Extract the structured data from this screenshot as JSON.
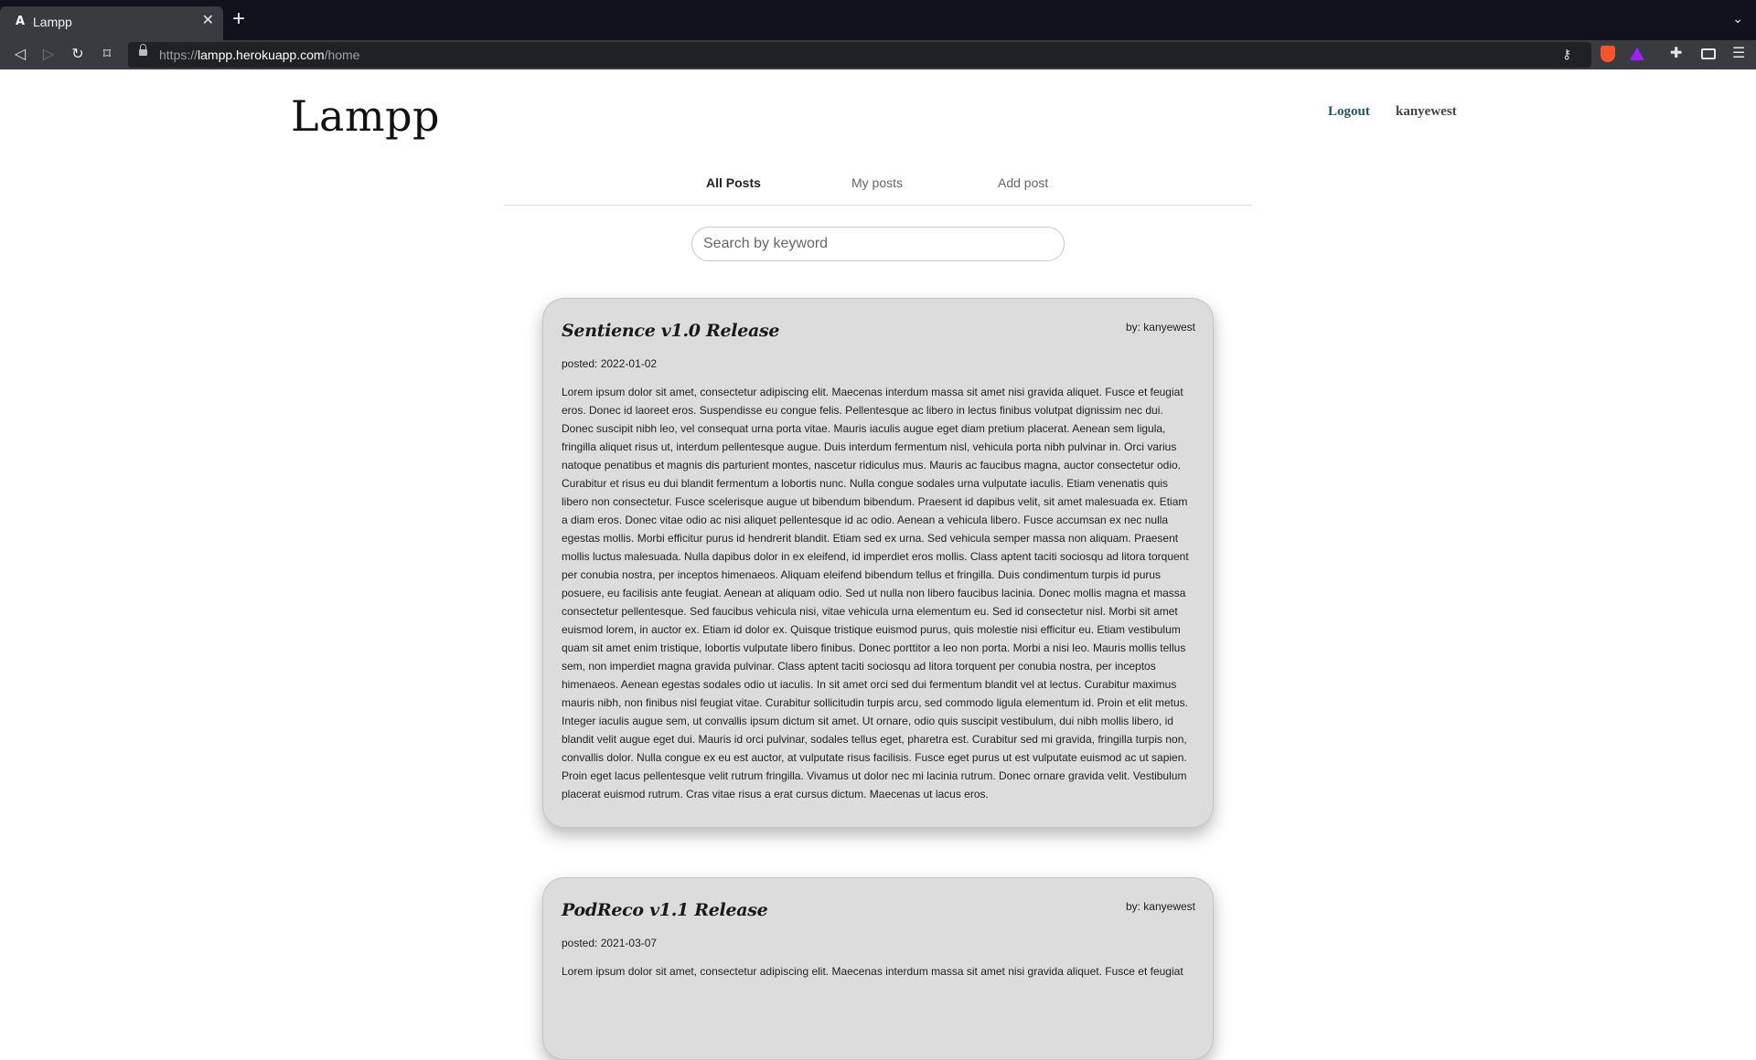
{
  "browser": {
    "tab": {
      "favicon": "A",
      "title": "Lampp",
      "close": "✕"
    },
    "new_tab": "+",
    "url": {
      "scheme": "https://",
      "host": "lampp.herokuapp.com",
      "path": "/home"
    },
    "icons": [
      "back-icon",
      "forward-icon",
      "reload-icon",
      "bookmark-icon",
      "lock-icon",
      "key-icon",
      "brave-shields-icon",
      "brave-rewards-icon",
      "extensions-icon",
      "wallet-icon",
      "menu-icon"
    ]
  },
  "header": {
    "logo": "Lampp",
    "logout_label": "Logout",
    "username": "kanyewest"
  },
  "nav": {
    "tabs": [
      {
        "label": "All Posts",
        "active": true
      },
      {
        "label": "My posts",
        "active": false
      },
      {
        "label": "Add post",
        "active": false
      }
    ]
  },
  "search": {
    "placeholder": "Search by keyword",
    "value": ""
  },
  "posts": [
    {
      "title": "Sentience v1.0 Release",
      "author": "by: kanyewest",
      "date": "posted: 2022-01-02",
      "body": "Lorem ipsum dolor sit amet, consectetur adipiscing elit. Maecenas interdum massa sit amet nisi gravida aliquet. Fusce et feugiat eros. Donec id laoreet eros. Suspendisse eu congue felis. Pellentesque ac libero in lectus finibus volutpat dignissim nec dui. Donec suscipit nibh leo, vel consequat urna porta vitae. Mauris iaculis augue eget diam pretium placerat. Aenean sem ligula, fringilla aliquet risus ut, interdum pellentesque augue. Duis interdum fermentum nisl, vehicula porta nibh pulvinar in. Orci varius natoque penatibus et magnis dis parturient montes, nascetur ridiculus mus. Mauris ac faucibus magna, auctor consectetur odio. Curabitur et risus eu dui blandit fermentum a lobortis nunc. Nulla congue sodales urna vulputate iaculis. Etiam venenatis quis libero non consectetur. Fusce scelerisque augue ut bibendum bibendum. Praesent id dapibus velit, sit amet malesuada ex. Etiam a diam eros. Donec vitae odio ac nisi aliquet pellentesque id ac odio. Aenean a vehicula libero. Fusce accumsan ex nec nulla egestas mollis. Morbi efficitur purus id hendrerit blandit. Etiam sed ex urna. Sed vehicula semper massa non aliquam. Praesent mollis luctus malesuada. Nulla dapibus dolor in ex eleifend, id imperdiet eros mollis. Class aptent taciti sociosqu ad litora torquent per conubia nostra, per inceptos himenaeos. Aliquam eleifend bibendum tellus et fringilla. Duis condimentum turpis id purus posuere, eu facilisis ante feugiat. Aenean at aliquam odio. Sed ut nulla non libero faucibus lacinia. Donec mollis magna et massa consectetur pellentesque. Sed faucibus vehicula nisi, vitae vehicula urna elementum eu. Sed id consectetur nisl. Morbi sit amet euismod lorem, in auctor ex. Etiam id dolor ex. Quisque tristique euismod purus, quis molestie nisi efficitur eu. Etiam vestibulum quam sit amet enim tristique, lobortis vulputate libero finibus. Donec porttitor a leo non porta. Morbi a nisi leo. Mauris mollis tellus sem, non imperdiet magna gravida pulvinar. Class aptent taciti sociosqu ad litora torquent per conubia nostra, per inceptos himenaeos. Aenean egestas sodales odio ut iaculis. In sit amet orci sed dui fermentum blandit vel at lectus. Curabitur maximus mauris nibh, non finibus nisl feugiat vitae. Curabitur sollicitudin turpis arcu, sed commodo ligula elementum id. Proin et elit metus. Integer iaculis augue sem, ut convallis ipsum dictum sit amet. Ut ornare, odio quis suscipit vestibulum, dui nibh mollis libero, id blandit velit augue eget dui. Mauris id orci pulvinar, sodales tellus eget, pharetra est. Curabitur sed mi gravida, fringilla turpis non, convallis dolor. Nulla congue ex eu est auctor, at vulputate risus facilisis. Fusce eget purus ut est vulputate euismod ac ut sapien. Proin eget lacus pellentesque velit rutrum fringilla. Vivamus ut dolor nec mi lacinia rutrum. Donec ornare gravida velit. Vestibulum placerat euismod rutrum. Cras vitae risus a erat cursus dictum. Maecenas ut lacus eros."
    },
    {
      "title": "PodReco v1.1 Release",
      "author": "by: kanyewest",
      "date": "posted: 2021-03-07",
      "body": "Lorem ipsum dolor sit amet, consectetur adipiscing elit. Maecenas interdum massa sit amet nisi gravida aliquet. Fusce et feugiat"
    }
  ]
}
